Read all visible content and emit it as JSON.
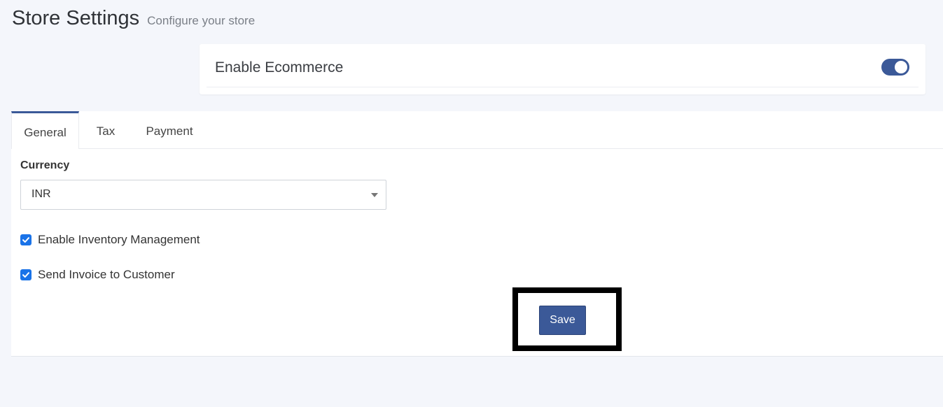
{
  "header": {
    "title": "Store Settings",
    "subtitle": "Configure your store"
  },
  "ecommerce": {
    "label": "Enable Ecommerce",
    "enabled": true
  },
  "tabs": [
    {
      "label": "General",
      "active": true
    },
    {
      "label": "Tax",
      "active": false
    },
    {
      "label": "Payment",
      "active": false
    }
  ],
  "general": {
    "currency_label": "Currency",
    "currency_value": "INR",
    "inventory": {
      "label": "Enable Inventory Management",
      "checked": true
    },
    "invoice": {
      "label": "Send Invoice to Customer",
      "checked": true
    }
  },
  "actions": {
    "save_label": "Save"
  },
  "colors": {
    "accent": "#3b5998",
    "checkbox": "#1a73e8",
    "background": "#f4f6fb"
  }
}
